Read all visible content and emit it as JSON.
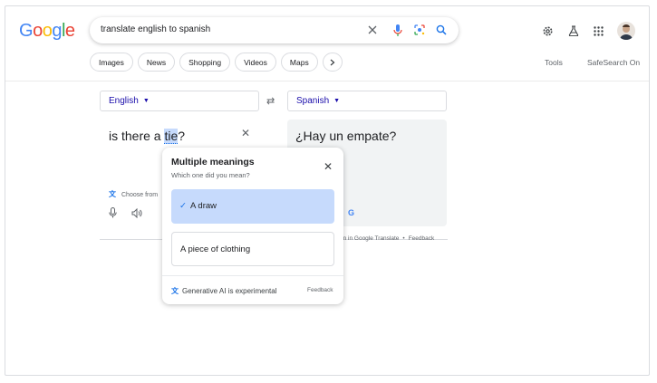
{
  "logo": {
    "letters": [
      "G",
      "o",
      "o",
      "g",
      "l",
      "e"
    ],
    "colors": [
      "#4285f4",
      "#ea4335",
      "#fbbc05",
      "#4285f4",
      "#34a853",
      "#ea4335"
    ]
  },
  "search": {
    "query": "translate english to spanish",
    "clear_icon": "close-icon",
    "mic_icon": "mic-icon",
    "lens_icon": "lens-icon",
    "search_icon": "search-icon"
  },
  "header_icons": [
    "gear-icon",
    "labs-flask-icon",
    "apps-grid-icon",
    "avatar"
  ],
  "chips": [
    "Images",
    "News",
    "Shopping",
    "Videos",
    "Maps"
  ],
  "tools_label": "Tools",
  "safesearch_label": "SafeSearch On",
  "translator": {
    "source_lang": "English",
    "target_lang": "Spanish",
    "source_text_before": "is there a ",
    "source_text_highlight": "tie",
    "source_text_after": "?",
    "target_text": "¿Hay un empate?",
    "choose_label": "Choose from",
    "footer_open": "en in Google Translate",
    "footer_feedback": "Feedback"
  },
  "popup": {
    "title": "Multiple meanings",
    "subtitle": "Which one did you mean?",
    "option_selected": "A draw",
    "option_other": "A piece of clothing",
    "footer_text": "Generative AI is experimental",
    "feedback": "Feedback"
  },
  "colors": {
    "accent": "#1a73e8",
    "selected_bg": "#c6dafc",
    "link": "#1a0dab"
  }
}
